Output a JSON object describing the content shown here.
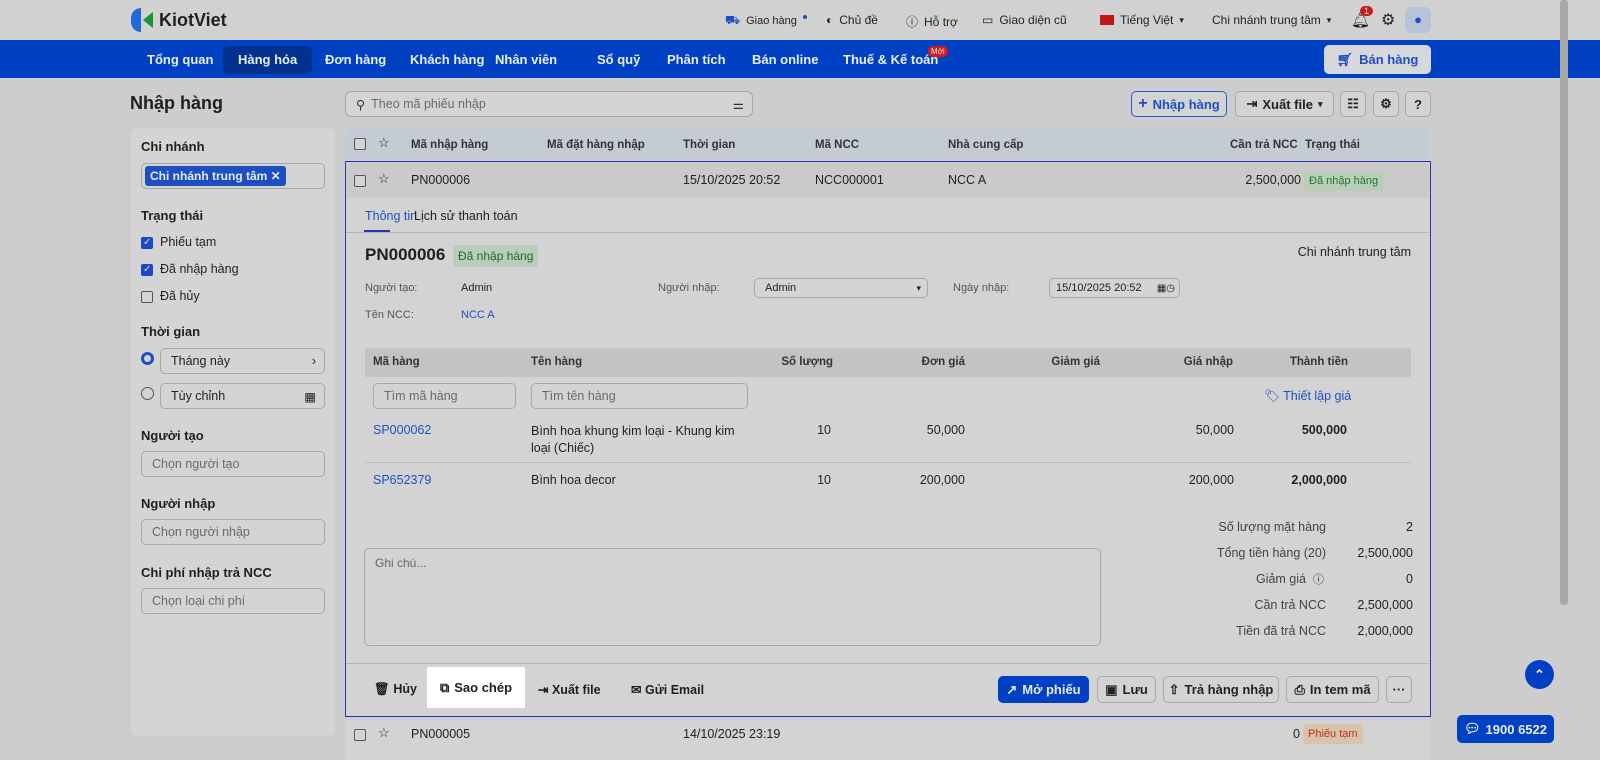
{
  "app": {
    "logo": "KiotViet"
  },
  "topbar": {
    "delivery": "Giao hàng",
    "theme": "Chủ đề",
    "support": "Hỗ trợ",
    "old_ui": "Giao diện cũ",
    "language": "Tiếng Việt",
    "branch": "Chi nhánh trung tâm",
    "notif_count": "1"
  },
  "nav": {
    "items": [
      "Tổng quan",
      "Hàng hóa",
      "Đơn hàng",
      "Khách hàng",
      "Nhân viên",
      "Sổ quỹ",
      "Phân tích",
      "Bán online",
      "Thuế & Kế toán"
    ],
    "new_badge": "Mới",
    "sell": "Bán hàng"
  },
  "page": {
    "title": "Nhập hàng",
    "search_placeholder": "Theo mã phiếu nhập",
    "add": "Nhập hàng",
    "export": "Xuất file"
  },
  "sidebar": {
    "branch_label": "Chi nhánh",
    "branch_tag": "Chi nhánh trung tâm",
    "status_label": "Trạng thái",
    "statuses": [
      "Phiếu tạm",
      "Đã nhập hàng",
      "Đã hủy"
    ],
    "time_label": "Thời gian",
    "time_opt1": "Tháng này",
    "time_opt2": "Tùy chỉnh",
    "creator_label": "Người tạo",
    "creator_ph": "Chọn người tạo",
    "importer_label": "Người nhập",
    "importer_ph": "Chọn người nhập",
    "cost_label": "Chi phí nhập trả NCC",
    "cost_ph": "Chọn loại chi phí"
  },
  "table": {
    "headers": [
      "Mã nhập hàng",
      "Mã đặt hàng nhập",
      "Thời gian",
      "Mã NCC",
      "Nhà cung cấp",
      "Cần trả NCC",
      "Trạng thái"
    ],
    "rows": [
      {
        "code": "PN000006",
        "time": "15/10/2025 20:52",
        "ncc_code": "NCC000001",
        "ncc": "NCC A",
        "due": "2,500,000",
        "status": "Đã nhập hàng"
      },
      {
        "code": "PN000005",
        "time": "14/10/2025 23:19",
        "due": "0",
        "status": "Phiếu tạm"
      }
    ]
  },
  "detail": {
    "tabs": [
      "Thông tin",
      "Lịch sử thanh toán"
    ],
    "code": "PN000006",
    "status": "Đã nhập hàng",
    "branch": "Chi nhánh trung tâm",
    "creator_label": "Người tạo:",
    "creator": "Admin",
    "importer_label": "Người nhập:",
    "importer": "Admin",
    "date_label": "Ngày nhập:",
    "date": "15/10/2025 20:52",
    "ncc_label": "Tên NCC:",
    "ncc": "NCC A",
    "item_headers": [
      "Mã hàng",
      "Tên hàng",
      "Số lượng",
      "Đơn giá",
      "Giảm giá",
      "Giá nhập",
      "Thành tiền"
    ],
    "search_code_ph": "Tìm mã hàng",
    "search_name_ph": "Tìm tên hàng",
    "set_price": "Thiết lập giá",
    "items": [
      {
        "code": "SP000062",
        "name": "Bình hoa khung kim loại - Khung kim loại (Chiếc)",
        "qty": "10",
        "price": "50,000",
        "import_price": "50,000",
        "total": "500,000"
      },
      {
        "code": "SP652379",
        "name": "Bình hoa decor",
        "qty": "10",
        "price": "200,000",
        "import_price": "200,000",
        "total": "2,000,000"
      }
    ],
    "note_ph": "Ghi chú...",
    "summary": [
      {
        "label": "Số lượng mặt hàng",
        "value": "2"
      },
      {
        "label": "Tổng tiền hàng (20)",
        "value": "2,500,000"
      },
      {
        "label": "Giảm giá",
        "value": "0"
      },
      {
        "label": "Cần trả NCC",
        "value": "2,500,000"
      },
      {
        "label": "Tiền đã trả NCC",
        "value": "2,000,000"
      }
    ],
    "actions": {
      "cancel": "Hủy",
      "copy": "Sao chép",
      "export": "Xuất file",
      "email": "Gửi Email",
      "open": "Mở phiếu",
      "save": "Lưu",
      "return": "Trả hàng nhập",
      "print": "In tem mã",
      "more": "···"
    }
  },
  "hotline": "1900 6522"
}
